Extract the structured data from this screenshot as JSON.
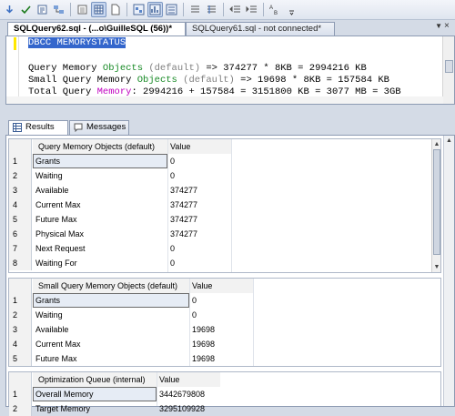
{
  "toolbar": {
    "icons": [
      "arrow-down-icon",
      "check-icon",
      "results-icon",
      "plan-icon",
      "grid-icon",
      "text-icon",
      "file-icon",
      "plan-icon-2",
      "stats-icon",
      "indent-icon",
      "comment-icon",
      "uncomment-icon",
      "outdent-icon",
      "indent-more-icon",
      "abc-icon",
      "more-icon"
    ]
  },
  "tabs": {
    "active": "SQLQuery62.sql - (...o\\GuilleSQL (56))*",
    "inactive": "SQLQuery61.sql - not connected*",
    "close": "×"
  },
  "editor": {
    "line1": "DBCC MEMORYSTATUS",
    "line2_a": "Query Memory ",
    "line2_b": "Objects",
    "line2_c": " (default) ",
    "line2_d": "=> 374277 * 8KB = 2994216 KB",
    "line3_a": "Small Query Memory ",
    "line3_b": "Objects",
    "line3_c": " (default) ",
    "line3_d": "=> 19698 * 8KB = 157584 KB",
    "line4_a": "Total Query ",
    "line4_b": "Memory",
    "line4_c": ": 2994216 + 157584 = 3151800 KB = 3077 MB = 3GB"
  },
  "result_tabs": {
    "results": "Results",
    "messages": "Messages"
  },
  "grid1": {
    "col1": "Query Memory Objects (default)",
    "col2": "Value",
    "rows": [
      [
        "1",
        "Grants",
        "0"
      ],
      [
        "2",
        "Waiting",
        "0"
      ],
      [
        "3",
        "Available",
        "374277"
      ],
      [
        "4",
        "Current Max",
        "374277"
      ],
      [
        "5",
        "Future Max",
        "374277"
      ],
      [
        "6",
        "Physical Max",
        "374277"
      ],
      [
        "7",
        "Next Request",
        "0"
      ],
      [
        "8",
        "Waiting For",
        "0"
      ]
    ]
  },
  "grid2": {
    "col1": "Small Query Memory Objects (default)",
    "col2": "Value",
    "rows": [
      [
        "1",
        "Grants",
        "0"
      ],
      [
        "2",
        "Waiting",
        "0"
      ],
      [
        "3",
        "Available",
        "19698"
      ],
      [
        "4",
        "Current Max",
        "19698"
      ],
      [
        "5",
        "Future Max",
        "19698"
      ]
    ]
  },
  "grid3": {
    "col1": "Optimization Queue (internal)",
    "col2": "Value",
    "rows": [
      [
        "1",
        "Overall Memory",
        "3442679808"
      ],
      [
        "2",
        "Target Memory",
        "3295109928"
      ]
    ]
  }
}
